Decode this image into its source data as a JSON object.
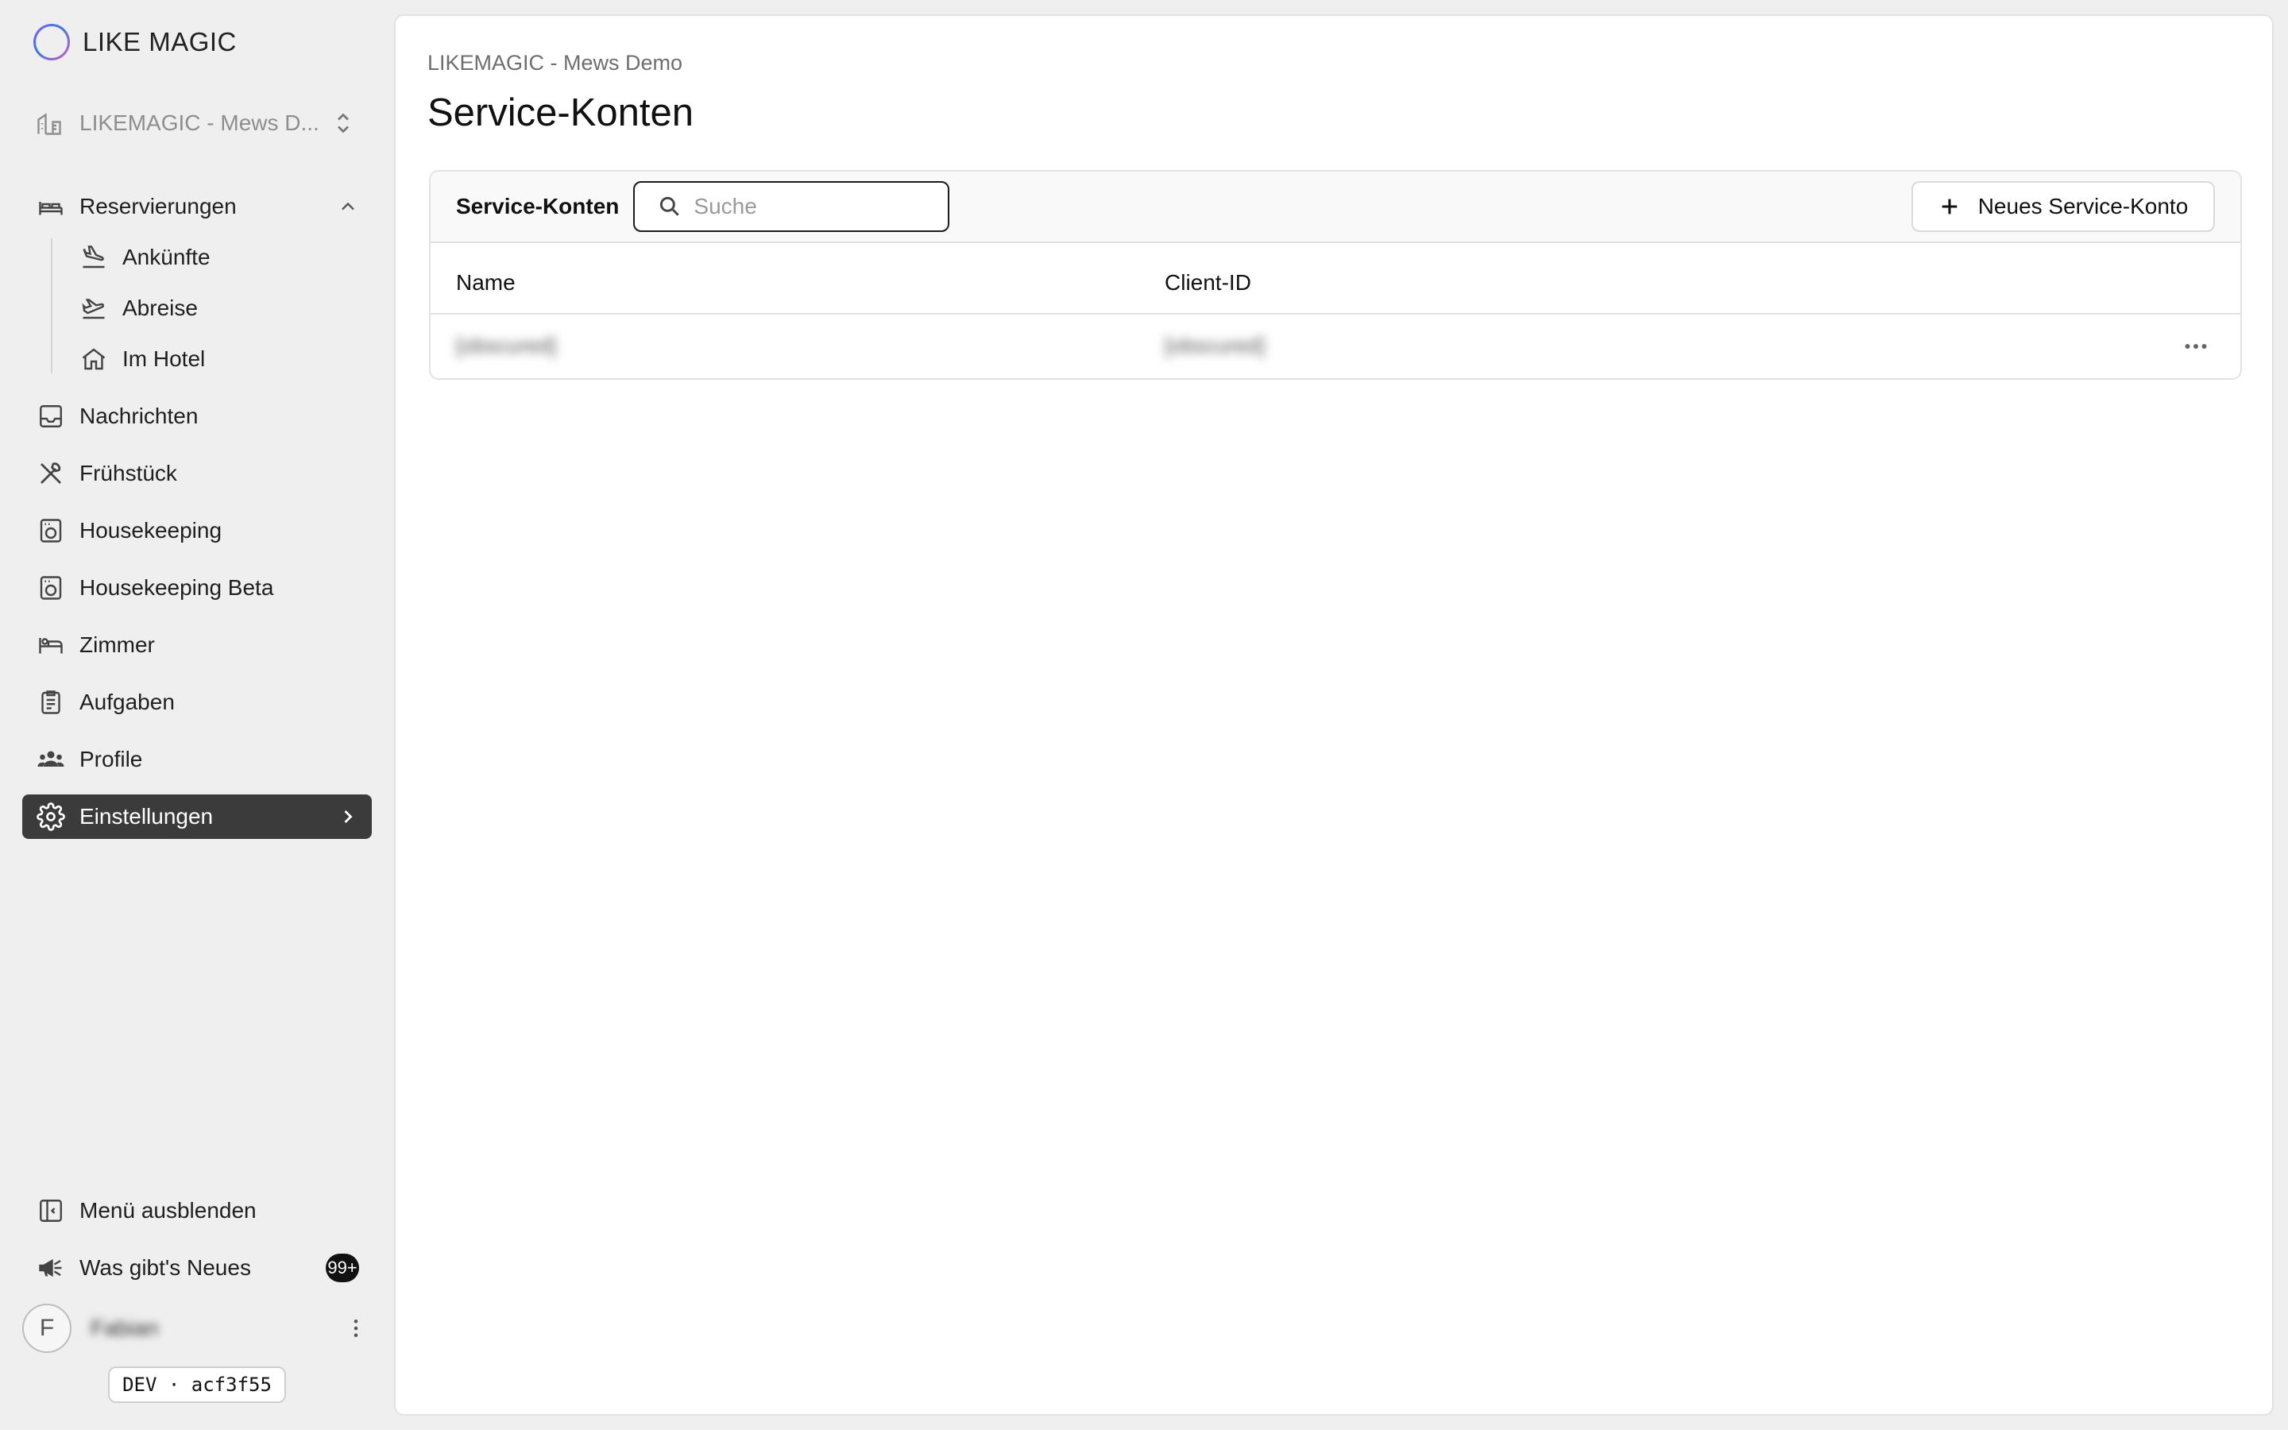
{
  "brand": {
    "name": "LIKE MAGIC"
  },
  "property_switcher": {
    "label": "LIKEMAGIC - Mews D..."
  },
  "nav": {
    "reservations": "Reservierungen",
    "arrivals": "Ankünfte",
    "departures": "Abreise",
    "in_hotel": "Im Hotel",
    "messages": "Nachrichten",
    "breakfast": "Frühstück",
    "housekeeping": "Housekeeping",
    "housekeeping_beta": "Housekeeping Beta",
    "rooms": "Zimmer",
    "tasks": "Aufgaben",
    "profiles": "Profile",
    "settings": "Einstellungen"
  },
  "footer": {
    "hide_menu": "Menü ausblenden",
    "whats_new": "Was gibt's Neues",
    "whats_new_badge": "99+",
    "avatar_initial": "F",
    "user_name": "Fabian",
    "build_tag": "DEV · acf3f55"
  },
  "main": {
    "breadcrumb": "LIKEMAGIC - Mews Demo",
    "title": "Service-Konten",
    "toolbar_title": "Service-Konten",
    "search_placeholder": "Suche",
    "new_button": "Neues Service-Konto",
    "columns": [
      "Name",
      "Client-ID"
    ],
    "rows": [
      {
        "name": "[obscured]",
        "client_id": "[obscured]"
      }
    ]
  },
  "colors": {
    "active_nav_bg": "#3b3b3b",
    "page_bg": "#efefef",
    "panel_bg": "#ffffff"
  }
}
